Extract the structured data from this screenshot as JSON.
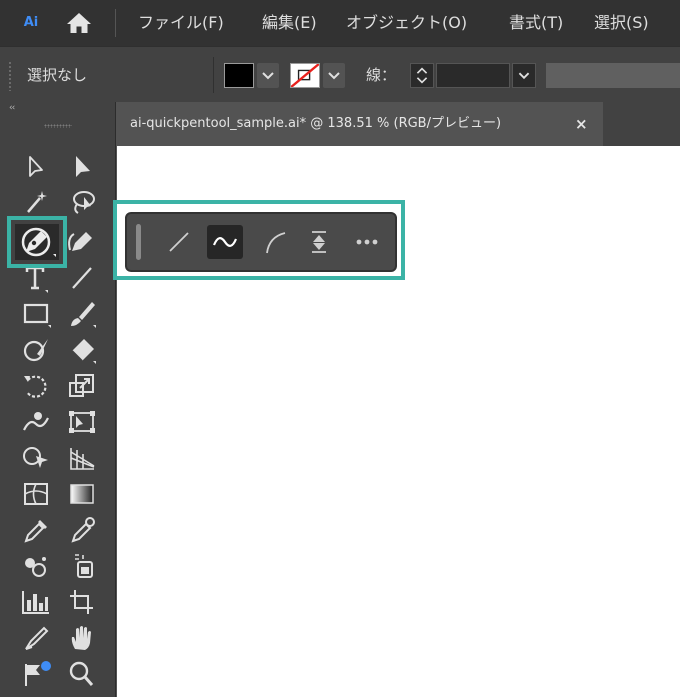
{
  "app": {
    "logo_text": "Ai"
  },
  "menu": {
    "items": [
      {
        "label": "ファイル(F)"
      },
      {
        "label": "編集(E)"
      },
      {
        "label": "オブジェクト(O)"
      },
      {
        "label": "書式(T)"
      },
      {
        "label": "選択(S)"
      }
    ]
  },
  "control_bar": {
    "selection_status": "選択なし",
    "fill_color": "#000000",
    "stroke_color": "none",
    "stroke_label": "線："
  },
  "toolbar": {
    "collapse_label": "‹‹",
    "selected_tool": "pen-tool",
    "tools": [
      "selection-tool",
      "direct-selection-tool",
      "magic-wand-tool",
      "lasso-tool",
      "pen-tool",
      "curvature-tool",
      "type-tool",
      "line-segment-tool",
      "rectangle-tool",
      "paintbrush-tool",
      "shaper-tool",
      "eraser-tool",
      "rotate-tool",
      "scale-tool",
      "warp-tool",
      "free-transform-tool",
      "shape-builder-tool",
      "perspective-grid-tool",
      "mesh-tool",
      "gradient-tool",
      "eyedropper-tool",
      "blend-tool",
      "symbol-sprayer-tool",
      "live-paint-tool",
      "column-graph-tool",
      "artboard-tool",
      "slice-tool",
      "hand-tool",
      "flag-tool",
      "zoom-tool"
    ]
  },
  "document": {
    "tab_title": "ai-quickpentool_sample.ai* @ 138.51 % (RGB/プレビュー)",
    "close_label": "×"
  },
  "pen_widget": {
    "buttons": [
      "straight-segment",
      "curve-segment",
      "smooth-corner",
      "anchor-convert",
      "more-options"
    ],
    "active_button": "curve-segment",
    "more_label": "•••"
  },
  "colors": {
    "highlight": "#3bb3a6",
    "menubar_bg": "#323232",
    "panel_bg": "#424242",
    "canvas_bg": "#ffffff",
    "app_accent": "#3f8df6"
  }
}
